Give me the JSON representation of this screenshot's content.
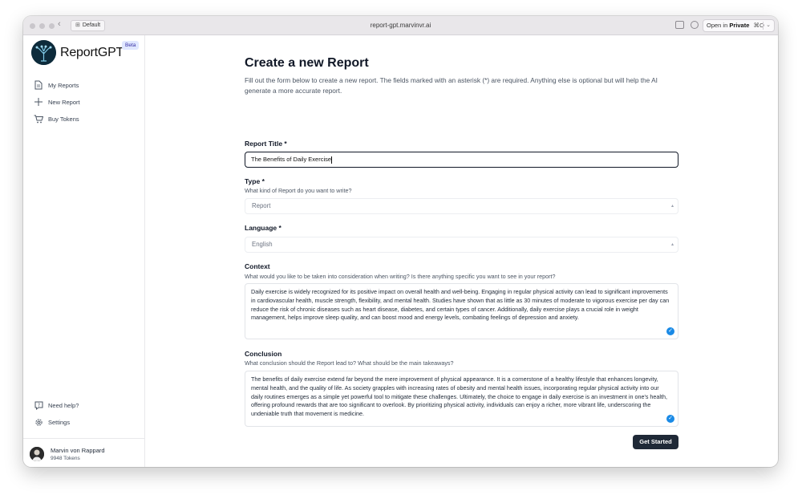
{
  "browser": {
    "profile_label": "Default",
    "url": "report-gpt.marvinvr.ai",
    "open_label_prefix": "Open in",
    "open_label_strong": "Private",
    "open_shortcut": "⌘O"
  },
  "sidebar": {
    "brand": "ReportGPT",
    "badge": "Beta",
    "items": [
      {
        "label": "My Reports",
        "icon": "document-icon"
      },
      {
        "label": "New Report",
        "icon": "plus-icon"
      },
      {
        "label": "Buy Tokens",
        "icon": "cart-icon"
      }
    ],
    "bottom_items": [
      {
        "label": "Need help?",
        "icon": "help-icon"
      },
      {
        "label": "Settings",
        "icon": "gear-icon"
      }
    ],
    "user": {
      "name": "Marvin von Rappard",
      "tokens": "9948 Tokens"
    }
  },
  "form": {
    "heading": "Create a new Report",
    "intro": "Fill out the form below to create a new report. The fields marked with an asterisk (*) are required. Anything else is optional but will help the AI generate a more accurate report.",
    "title": {
      "label": "Report Title *",
      "value": "The Benefits of Daily Exercise"
    },
    "type": {
      "label": "Type *",
      "hint": "What kind of Report do you want to write?",
      "value": "Report"
    },
    "language": {
      "label": "Language *",
      "value": "English"
    },
    "context": {
      "label": "Context",
      "hint": "What would you like to be taken into consideration when writing? Is there anything specific you want to see in your report?",
      "value": "Daily exercise is widely recognized for its positive impact on overall health and well-being. Engaging in regular physical activity can lead to significant improvements in cardiovascular health, muscle strength, flexibility, and mental health. Studies have shown that as little as 30 minutes of moderate to vigorous exercise per day can reduce the risk of chronic diseases such as heart disease, diabetes, and certain types of cancer. Additionally, daily exercise plays a crucial role in weight management, helps improve sleep quality, and can boost mood and energy levels, combating feelings of depression and anxiety."
    },
    "conclusion": {
      "label": "Conclusion",
      "hint": "What conclusion should the Report lead to? What should be the main takeaways?",
      "value": "The benefits of daily exercise extend far beyond the mere improvement of physical appearance. It is a cornerstone of a healthy lifestyle that enhances longevity, mental health, and the quality of life. As society grapples with increasing rates of obesity and mental health issues, incorporating regular physical activity into our daily routines emerges as a simple yet powerful tool to mitigate these challenges. Ultimately, the choice to engage in daily exercise is an investment in one's health, offering profound rewards that are too significant to overlook. By prioritizing physical activity, individuals can enjoy a richer, more vibrant life, underscoring the undeniable truth that movement is medicine."
    },
    "submit_label": "Get Started"
  },
  "colors": {
    "accent": "#1f2937",
    "check": "#1a8ae6",
    "badge_bg": "#e0e7ff"
  }
}
